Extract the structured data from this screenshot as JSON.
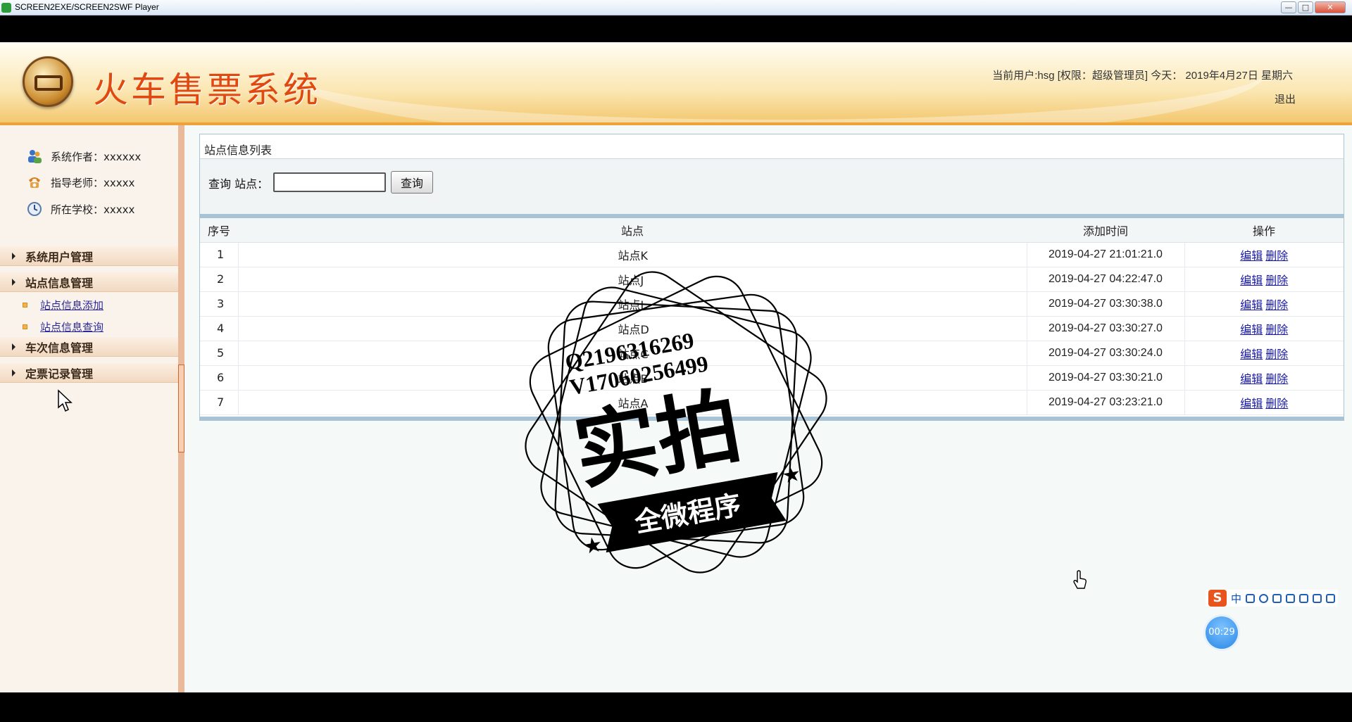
{
  "window": {
    "title": "SCREEN2EXE/SCREEN2SWF Player",
    "buttons": [
      "—",
      "□",
      "✕"
    ]
  },
  "header": {
    "system_title": "火车售票系统",
    "user_info": "当前用户:hsg [权限：超级管理员] 今天：  2019年4月27日 星期六",
    "logout": "退出"
  },
  "sidebar": {
    "info": [
      {
        "label": "系统作者：xxxxxx",
        "icon": "users-icon"
      },
      {
        "label": "指导老师：xxxxx",
        "icon": "phone-icon"
      },
      {
        "label": "所在学校：xxxxx",
        "icon": "clock-icon"
      }
    ],
    "menus": [
      {
        "label": "系统用户管理"
      },
      {
        "label": "站点信息管理",
        "children": [
          "站点信息添加",
          "站点信息查询"
        ]
      },
      {
        "label": "车次信息管理"
      },
      {
        "label": "定票记录管理"
      }
    ]
  },
  "panel": {
    "title": "站点信息列表",
    "search_label": "查询 站点：",
    "search_value": "",
    "search_button": "查询"
  },
  "table": {
    "headers": [
      "序号",
      "站点",
      "添加时间",
      "操作"
    ],
    "rows": [
      {
        "idx": "1",
        "name": "站点K",
        "time": "2019-04-27 21:01:21.0"
      },
      {
        "idx": "2",
        "name": "站点J",
        "time": "2019-04-27 04:22:47.0"
      },
      {
        "idx": "3",
        "name": "站点I",
        "time": "2019-04-27 03:30:38.0"
      },
      {
        "idx": "4",
        "name": "站点D",
        "time": "2019-04-27 03:30:27.0"
      },
      {
        "idx": "5",
        "name": "站点C",
        "time": "2019-04-27 03:30:24.0"
      },
      {
        "idx": "6",
        "name": "站点B",
        "time": "2019-04-27 03:30:21.0"
      },
      {
        "idx": "7",
        "name": "站点A",
        "time": "2019-04-27 03:23:21.0"
      }
    ],
    "edit_label": "编辑",
    "delete_label": "删除"
  },
  "watermark": {
    "line1": "Q2196316269",
    "line2": "V17060256499",
    "main": "实拍",
    "banner": "全微程序"
  },
  "ime": {
    "logo": "S",
    "lang": "中"
  },
  "timer": "00:29"
}
